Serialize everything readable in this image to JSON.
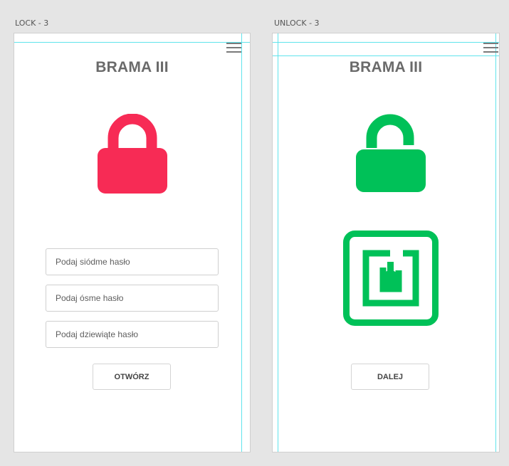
{
  "artboards": {
    "lock": {
      "label": "LOCK - 3"
    },
    "unlock": {
      "label": "UNLOCK - 3"
    }
  },
  "lock_screen": {
    "title": "BRAMA III",
    "inputs": [
      {
        "placeholder": "Podaj siódme hasło",
        "value": ""
      },
      {
        "placeholder": "Podaj ósme hasło",
        "value": ""
      },
      {
        "placeholder": "Podaj dziewiąte hasło",
        "value": ""
      }
    ],
    "button_label": "OTWÓRZ",
    "lock_icon": "padlock-closed-icon",
    "lock_color": "#f72b55"
  },
  "unlock_screen": {
    "title": "BRAMA III",
    "button_label": "DALEJ",
    "unlock_icon": "padlock-open-icon",
    "nfc_icon": "nfc-icon",
    "accent_color": "#00c158"
  },
  "menu_icon": "hamburger-menu-icon"
}
